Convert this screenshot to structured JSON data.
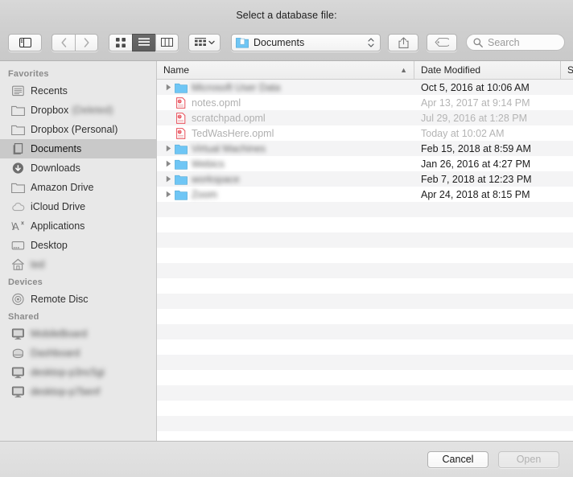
{
  "window": {
    "title": "Select a database file:"
  },
  "toolbar": {
    "sidebar_toggle_icon": "sidebar-toggle-icon",
    "back_icon": "chevron-left-icon",
    "forward_icon": "chevron-right-icon",
    "view_icon_label": "icon-view-icon",
    "view_list_label": "list-view-icon",
    "view_column_label": "column-view-icon",
    "arrange_label": "arrange-by-icon",
    "path_label": "Documents",
    "share_icon": "share-icon",
    "tag_icon": "tag-icon",
    "search_placeholder": "Search",
    "search_value": ""
  },
  "sidebar": {
    "sections": [
      {
        "header": "Favorites",
        "items": [
          {
            "label": "Recents",
            "icon": "recents-icon",
            "selected": false,
            "blurred": false
          },
          {
            "label": "Dropbox",
            "suffix": "(Deleted)",
            "icon": "folder-icon",
            "selected": false,
            "blurred": false,
            "partial_blur": true
          },
          {
            "label": "Dropbox (Personal)",
            "icon": "folder-icon",
            "selected": false,
            "blurred": false
          },
          {
            "label": "Documents",
            "icon": "documents-icon",
            "selected": true,
            "blurred": false
          },
          {
            "label": "Downloads",
            "icon": "downloads-icon",
            "selected": false,
            "blurred": false
          },
          {
            "label": "Amazon Drive",
            "icon": "folder-icon",
            "selected": false,
            "blurred": false
          },
          {
            "label": "iCloud Drive",
            "icon": "icloud-icon",
            "selected": false,
            "blurred": false
          },
          {
            "label": "Applications",
            "icon": "applications-icon",
            "selected": false,
            "blurred": false
          },
          {
            "label": "Desktop",
            "icon": "desktop-icon",
            "selected": false,
            "blurred": false
          },
          {
            "label": "ted",
            "icon": "home-icon",
            "selected": false,
            "blurred": true
          }
        ]
      },
      {
        "header": "Devices",
        "items": [
          {
            "label": "Remote Disc",
            "icon": "optical-disc-icon",
            "selected": false,
            "blurred": false
          }
        ]
      },
      {
        "header": "Shared",
        "items": [
          {
            "label": "MobileBoard",
            "icon": "display-icon",
            "selected": false,
            "blurred": true
          },
          {
            "label": "Dashboard",
            "icon": "server-icon",
            "selected": false,
            "blurred": true
          },
          {
            "label": "desktop-p3nc5gi",
            "icon": "display-icon",
            "selected": false,
            "blurred": true
          },
          {
            "label": "desktop-p7benf",
            "icon": "display-icon",
            "selected": false,
            "blurred": true
          }
        ]
      }
    ]
  },
  "filelist": {
    "columns": [
      {
        "label": "Name",
        "sort": "ascending"
      },
      {
        "label": "Date Modified",
        "sort": "none"
      },
      {
        "label": "S",
        "sort": "none"
      }
    ],
    "rows": [
      {
        "name": "Microsoft User Data",
        "date": "Oct 5, 2016 at 10:06 AM",
        "size": "",
        "type": "folder",
        "expandable": true,
        "disabled": false,
        "blurred": true
      },
      {
        "name": "notes.opml",
        "date": "Apr 13, 2017 at 9:14 PM",
        "size": "",
        "type": "opml",
        "expandable": false,
        "disabled": true,
        "blurred": false
      },
      {
        "name": "scratchpad.opml",
        "date": "Jul 29, 2016 at 1:28 PM",
        "size": "",
        "type": "opml",
        "expandable": false,
        "disabled": true,
        "blurred": false
      },
      {
        "name": "TedWasHere.opml",
        "date": "Today at 10:02 AM",
        "size": "",
        "type": "opml",
        "expandable": false,
        "disabled": true,
        "blurred": false
      },
      {
        "name": "Virtual Machines",
        "date": "Feb 15, 2018 at 8:59 AM",
        "size": "",
        "type": "folder",
        "expandable": true,
        "disabled": false,
        "blurred": true
      },
      {
        "name": "Webics",
        "date": "Jan 26, 2016 at 4:27 PM",
        "size": "",
        "type": "folder",
        "expandable": true,
        "disabled": false,
        "blurred": true
      },
      {
        "name": "workspace",
        "date": "Feb 7, 2018 at 12:23 PM",
        "size": "",
        "type": "folder",
        "expandable": true,
        "disabled": false,
        "blurred": true
      },
      {
        "name": "Zoom",
        "date": "Apr 24, 2018 at 8:15 PM",
        "size": "",
        "type": "folder",
        "expandable": true,
        "disabled": false,
        "blurred": true
      }
    ],
    "empty_row_count": 15
  },
  "footer": {
    "cancel_label": "Cancel",
    "open_label": "Open",
    "open_enabled": false
  },
  "colors": {
    "folder_blue": "#6fc6f5",
    "opml_red": "#e8505b",
    "selection_grey": "#c9c9c9",
    "stripe": "#f4f4f5"
  }
}
